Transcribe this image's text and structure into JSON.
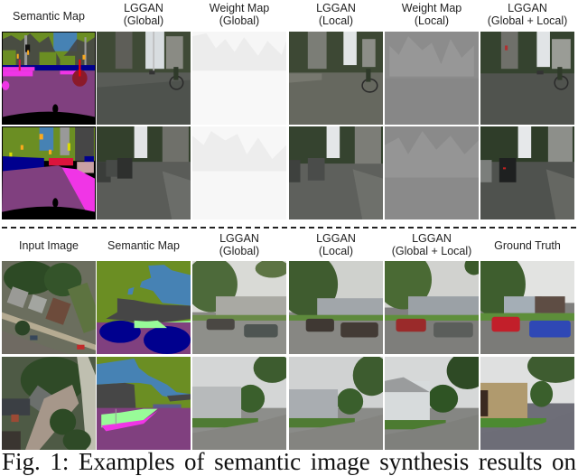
{
  "figure": {
    "top_section": {
      "headers": [
        {
          "line1": "Semantic Map",
          "line2": ""
        },
        {
          "line1": "LGGAN",
          "line2": "(Global)"
        },
        {
          "line1": "Weight Map",
          "line2": "(Global)"
        },
        {
          "line1": "LGGAN",
          "line2": "(Local)"
        },
        {
          "line1": "Weight Map",
          "line2": "(Local)"
        },
        {
          "line1": "LGGAN",
          "line2": "(Global + Local)"
        }
      ],
      "rows": [
        {
          "images": [
            "cityscapes-semantic-map-1",
            "cityscapes-lggan-global-1",
            "weight-map-global-1",
            "cityscapes-lggan-local-1",
            "weight-map-local-1",
            "cityscapes-lggan-global-local-1"
          ]
        },
        {
          "images": [
            "cityscapes-semantic-map-2",
            "cityscapes-lggan-global-2",
            "weight-map-global-2",
            "cityscapes-lggan-local-2",
            "weight-map-local-2",
            "cityscapes-lggan-global-local-2"
          ]
        }
      ]
    },
    "bottom_section": {
      "headers": [
        {
          "line1": "Input Image",
          "line2": ""
        },
        {
          "line1": "Semantic Map",
          "line2": ""
        },
        {
          "line1": "LGGAN",
          "line2": "(Global)"
        },
        {
          "line1": "LGGAN",
          "line2": "(Local)"
        },
        {
          "line1": "LGGAN",
          "line2": "(Global + Local)"
        },
        {
          "line1": "Ground Truth",
          "line2": ""
        }
      ],
      "rows": [
        {
          "images": [
            "aerial-input-1",
            "aerial-semantic-map-1",
            "streetview-lggan-global-1",
            "streetview-lggan-local-1",
            "streetview-lggan-global-local-1",
            "streetview-ground-truth-1"
          ]
        },
        {
          "images": [
            "aerial-input-2",
            "aerial-semantic-map-2",
            "streetview-lggan-global-2",
            "streetview-lggan-local-2",
            "streetview-lggan-global-local-2",
            "streetview-ground-truth-2"
          ]
        }
      ]
    },
    "caption": "Fig. 1: Examples of semantic image synthesis results on",
    "palette": {
      "road": "#80407f",
      "sidewalk": "#f035e6",
      "vegetation": "#6b8e23",
      "sky": "#4682b4",
      "building": "#464646",
      "car": "#00008e",
      "terrain": "#98fb98",
      "person": "#dc143c",
      "rider": "#ff0000",
      "pole": "#999999",
      "traffic_sign": "#dcdc00",
      "traffic_light": "#faaa1e",
      "void": "#000000"
    }
  }
}
